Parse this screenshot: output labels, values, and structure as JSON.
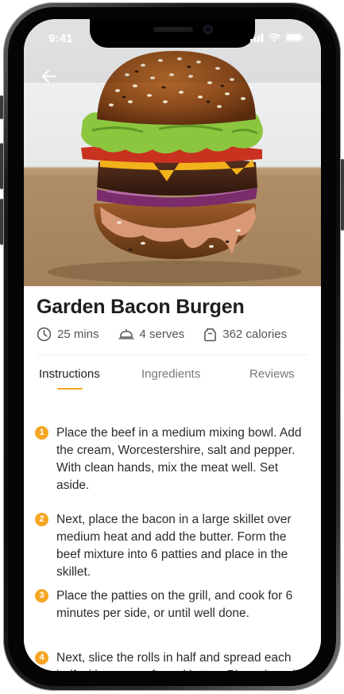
{
  "status_bar": {
    "time": "9:41"
  },
  "recipe": {
    "title": "Garden Bacon Burgen",
    "meta": {
      "time": "25 mins",
      "serves": "4 serves",
      "calories": "362 calories"
    }
  },
  "tabs": [
    {
      "label": "Instructions",
      "active": true
    },
    {
      "label": "Ingredients",
      "active": false
    },
    {
      "label": "Reviews",
      "active": false
    }
  ],
  "steps": [
    {
      "number": "1",
      "text": "Place the beef in a medium mixing bowl. Add the cream, Worcestershire, salt and pepper. With clean hands, mix the meat well. Set aside."
    },
    {
      "number": "2",
      "text": "Next, place the bacon in a large skillet over medium heat and add the butter. Form the beef mixture into 6 patties and place in the skillet."
    },
    {
      "number": "3",
      "text": "Place the patties on the grill, and cook for 6 minutes per side, or until well done."
    },
    {
      "number": "4",
      "text": "Next, slice the rolls in half and spread each half with some softened butter. Place the rolls face down on a skillet to"
    }
  ],
  "colors": {
    "accent": "#f5a623",
    "title": "#1e1e1e",
    "text": "#2b2b2b",
    "muted": "#7a7a7a"
  },
  "icons": [
    "back-arrow-icon",
    "clock-icon",
    "serving-cloche-icon",
    "calorie-jar-icon",
    "signal-icon",
    "wifi-icon",
    "battery-icon"
  ]
}
